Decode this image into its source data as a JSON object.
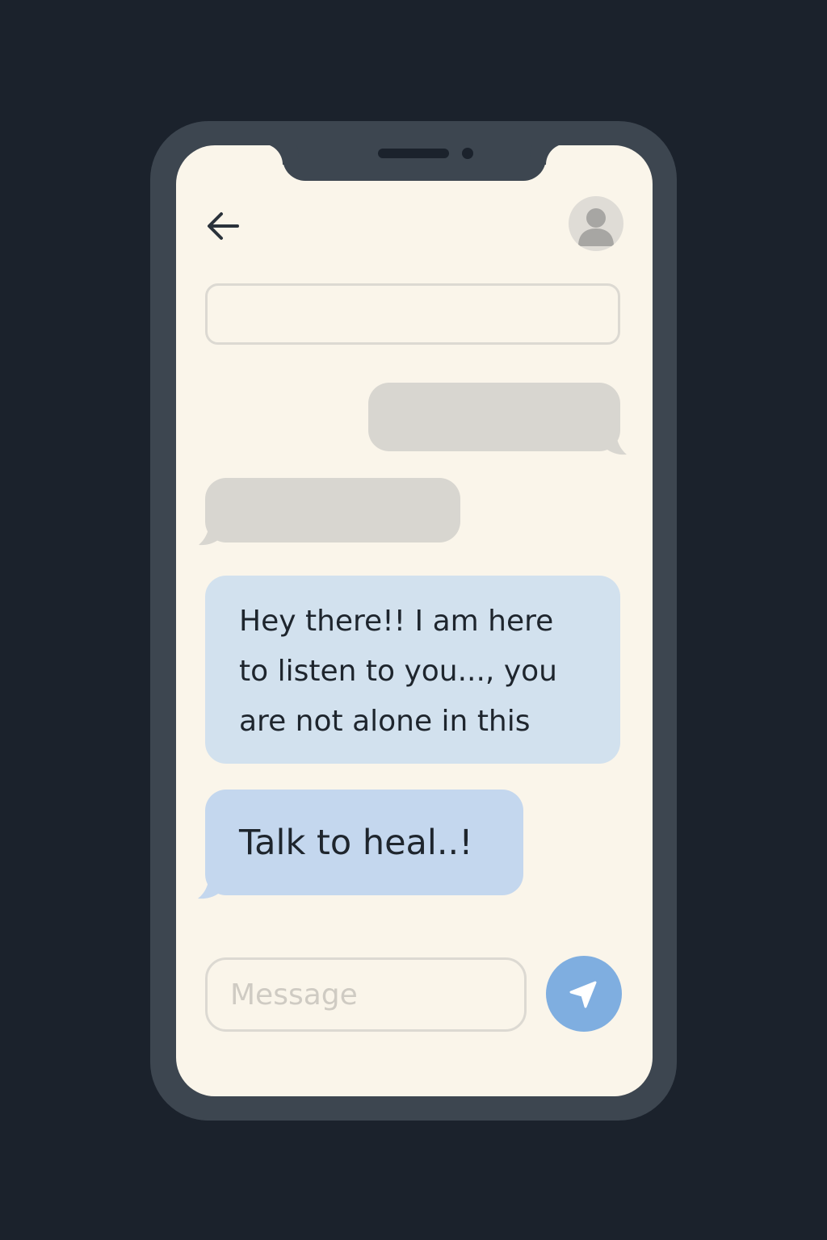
{
  "colors": {
    "background": "#1b222c",
    "phone_frame": "#3d4650",
    "screen": "#faf5ea",
    "placeholder_bubble": "#d8d6d0",
    "message_bubble_light_blue": "#d2e1ee",
    "message_bubble_blue": "#c4d7ee",
    "send_button": "#7faee0",
    "text": "#1e252d"
  },
  "header": {
    "back_icon": "arrow-left-icon",
    "avatar_icon": "user-avatar-icon"
  },
  "top_field": {
    "value": ""
  },
  "messages": [
    {
      "text": "",
      "direction": "sent",
      "style": "placeholder"
    },
    {
      "text": "",
      "direction": "received",
      "style": "placeholder"
    },
    {
      "text": "Hey there!! I am here\nto listen to you..., you\nare not alone in this",
      "direction": "received",
      "style": "light-blue"
    },
    {
      "text": "Talk to heal..!",
      "direction": "received",
      "style": "blue"
    }
  ],
  "composer": {
    "placeholder": "Message",
    "value": "",
    "send_icon": "send-arrow-icon"
  }
}
